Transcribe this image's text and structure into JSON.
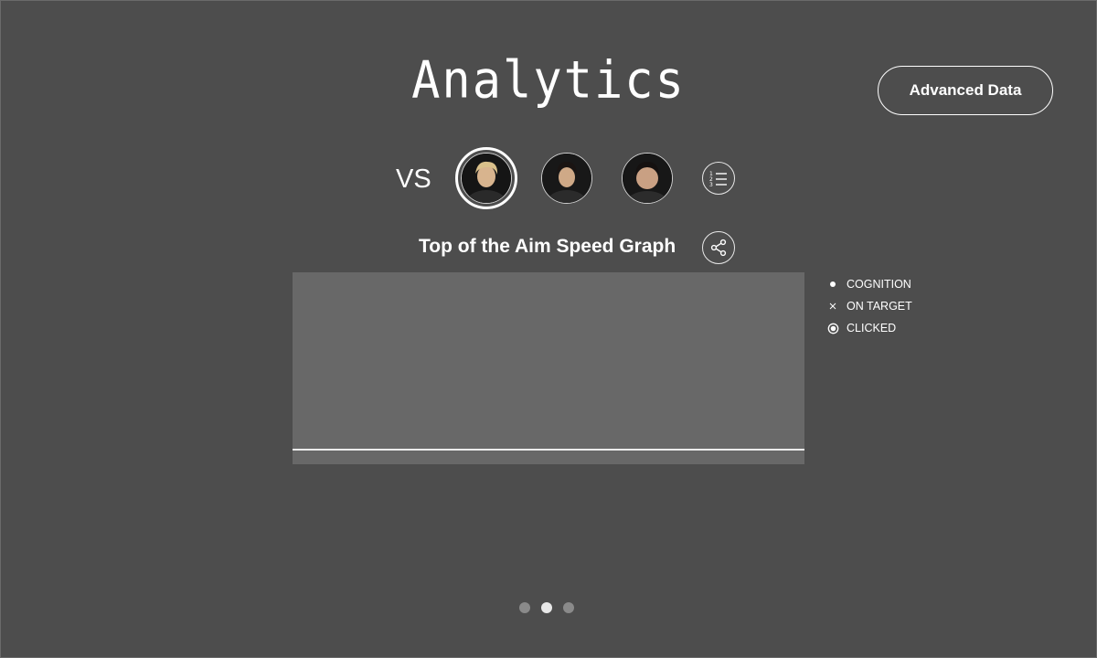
{
  "header": {
    "title": "Analytics",
    "advanced_button_label": "Advanced Data"
  },
  "compare": {
    "vs_label": "VS",
    "players": [
      {
        "name": "player-1",
        "selected": true
      },
      {
        "name": "player-2",
        "selected": false
      },
      {
        "name": "player-3",
        "selected": false
      }
    ],
    "ranking_icon": "ranking-list-icon"
  },
  "graph": {
    "title": "Top of the Aim Speed Graph",
    "share_icon": "share-icon",
    "legend": [
      {
        "label": "COGNITION",
        "icon": "dot-marker-icon"
      },
      {
        "label": "ON TARGET",
        "icon": "x-marker-icon"
      },
      {
        "label": "CLICKED",
        "icon": "ring-marker-icon"
      }
    ]
  },
  "chart_data": {
    "type": "line",
    "title": "Top of the Aim Speed Graph",
    "series": [],
    "legend": [
      "COGNITION",
      "ON TARGET",
      "CLICKED"
    ],
    "legend_position": "right",
    "grid": false
  },
  "pagination": {
    "pages": 3,
    "current": 2
  },
  "colors": {
    "background": "#4d4d4d",
    "plot_background": "#686868",
    "foreground": "#ffffff",
    "inactive_dot": "#8a8a8a"
  }
}
